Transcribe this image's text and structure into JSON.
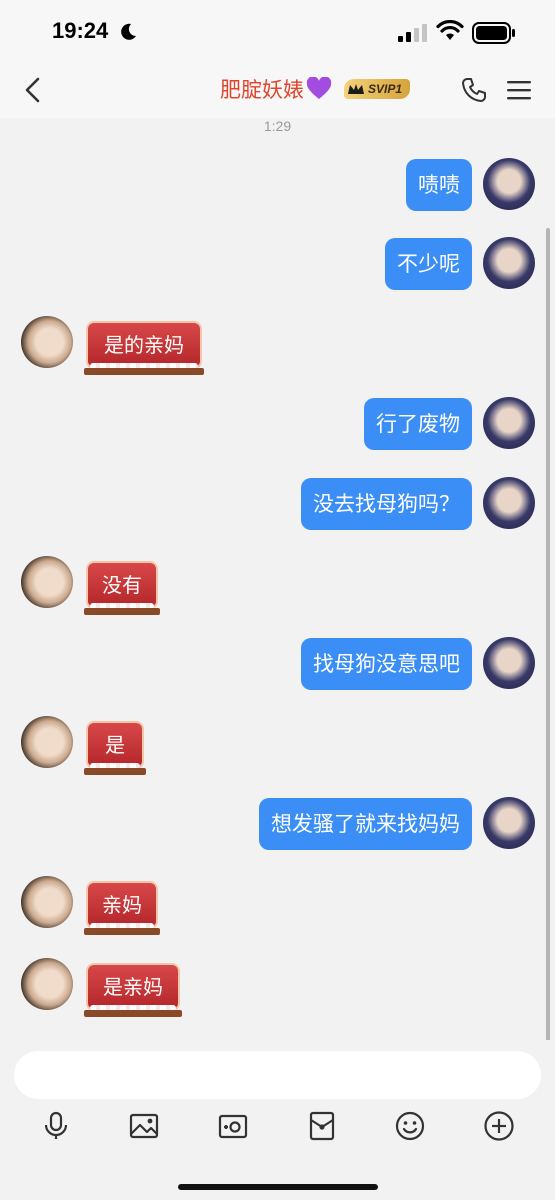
{
  "status_bar": {
    "time": "19:24"
  },
  "nav": {
    "title": "肥腚妖婊",
    "badge": "SVIP1"
  },
  "chat": {
    "timestamp": "1:29",
    "messages": [
      {
        "from": "me",
        "text": "啧啧"
      },
      {
        "from": "me",
        "text": "不少呢"
      },
      {
        "from": "her",
        "text": "是的亲妈"
      },
      {
        "from": "me",
        "text": "行了废物"
      },
      {
        "from": "me",
        "text": "没去找母狗吗？"
      },
      {
        "from": "her",
        "text": "没有"
      },
      {
        "from": "me",
        "text": "找母狗没意思吧"
      },
      {
        "from": "her",
        "text": "是"
      },
      {
        "from": "me",
        "text": "想发骚了就来找妈妈"
      },
      {
        "from": "her",
        "text": "亲妈"
      },
      {
        "from": "her",
        "text": "是亲妈"
      }
    ]
  },
  "toolbar": {
    "icons": [
      "mic-icon",
      "image-icon",
      "camera-icon",
      "red-packet-icon",
      "emoji-icon",
      "plus-icon"
    ]
  },
  "colors": {
    "accent": "#3a8ef6",
    "title": "#e0452d",
    "sticker": "#c0302f"
  }
}
